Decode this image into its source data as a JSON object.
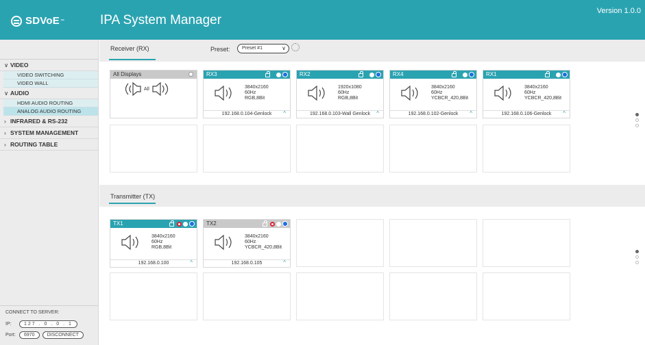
{
  "header": {
    "logo_text": "SDVoE",
    "logo_tm": "™",
    "app_title": "IPA System Manager",
    "version": "Version 1.0.0"
  },
  "sidebar": {
    "groups": [
      {
        "label": "VIDEO",
        "expanded": true,
        "items": [
          "VIDEO SWITCHING",
          "VIDEO WALL"
        ]
      },
      {
        "label": "AUDIO",
        "expanded": true,
        "items": [
          "HDMI AUDIO ROUTING",
          "ANALOG AUDIO ROUTING"
        ]
      },
      {
        "label": "INFRARED & RS-232",
        "expanded": false
      },
      {
        "label": "SYSTEM MANAGEMENT",
        "expanded": false
      },
      {
        "label": "ROUTING TABLE",
        "expanded": false
      }
    ],
    "active_item": "ANALOG AUDIO ROUTING",
    "connect": {
      "title": "CONNECT TO SERVER:",
      "ip_label": "IP:",
      "ip_value": "127 . 0 . 0 . 1",
      "port_label": "Port:",
      "port_value": "6970",
      "disconnect_label": "DISCONNECT"
    }
  },
  "receiver": {
    "tab_label": "Receiver (RX)",
    "preset_label": "Preset:",
    "preset_value": "Preset #1",
    "all_displays": {
      "title": "All Displays",
      "all_label": "All"
    },
    "cards": [
      {
        "name": "RX3",
        "res": "3840x2160",
        "hz": "60Hz",
        "fmt": "RGB,8Bit",
        "footer": "192.168.0.104-Genlock"
      },
      {
        "name": "RX2",
        "res": "1920x1080",
        "hz": "60Hz",
        "fmt": "RGB,8Bit",
        "footer": "192.168.0.103-Wall Genlock"
      },
      {
        "name": "RX4",
        "res": "3840x2160",
        "hz": "60Hz",
        "fmt": "YCBCR_420,8Bit",
        "footer": "192.168.0.102-Genlock"
      },
      {
        "name": "RX1",
        "res": "3840x2160",
        "hz": "60Hz",
        "fmt": "YCBCR_420,8Bit",
        "footer": "192.168.0.106-Genlock"
      }
    ]
  },
  "transmitter": {
    "tab_label": "Transmitter (TX)",
    "cards": [
      {
        "name": "TX1",
        "res": "3840x2160",
        "hz": "60Hz",
        "fmt": "RGB,8Bit",
        "footer": "192.168.0.100",
        "selected": true
      },
      {
        "name": "TX2",
        "res": "3840x2160",
        "hz": "60Hz",
        "fmt": "YCBCR_420,8Bit",
        "footer": "192.168.0.105",
        "selected": false
      }
    ]
  },
  "colors": {
    "accent": "#2aa3b1",
    "active_blue": "#1a6fe0",
    "status_red": "#dd2233"
  }
}
